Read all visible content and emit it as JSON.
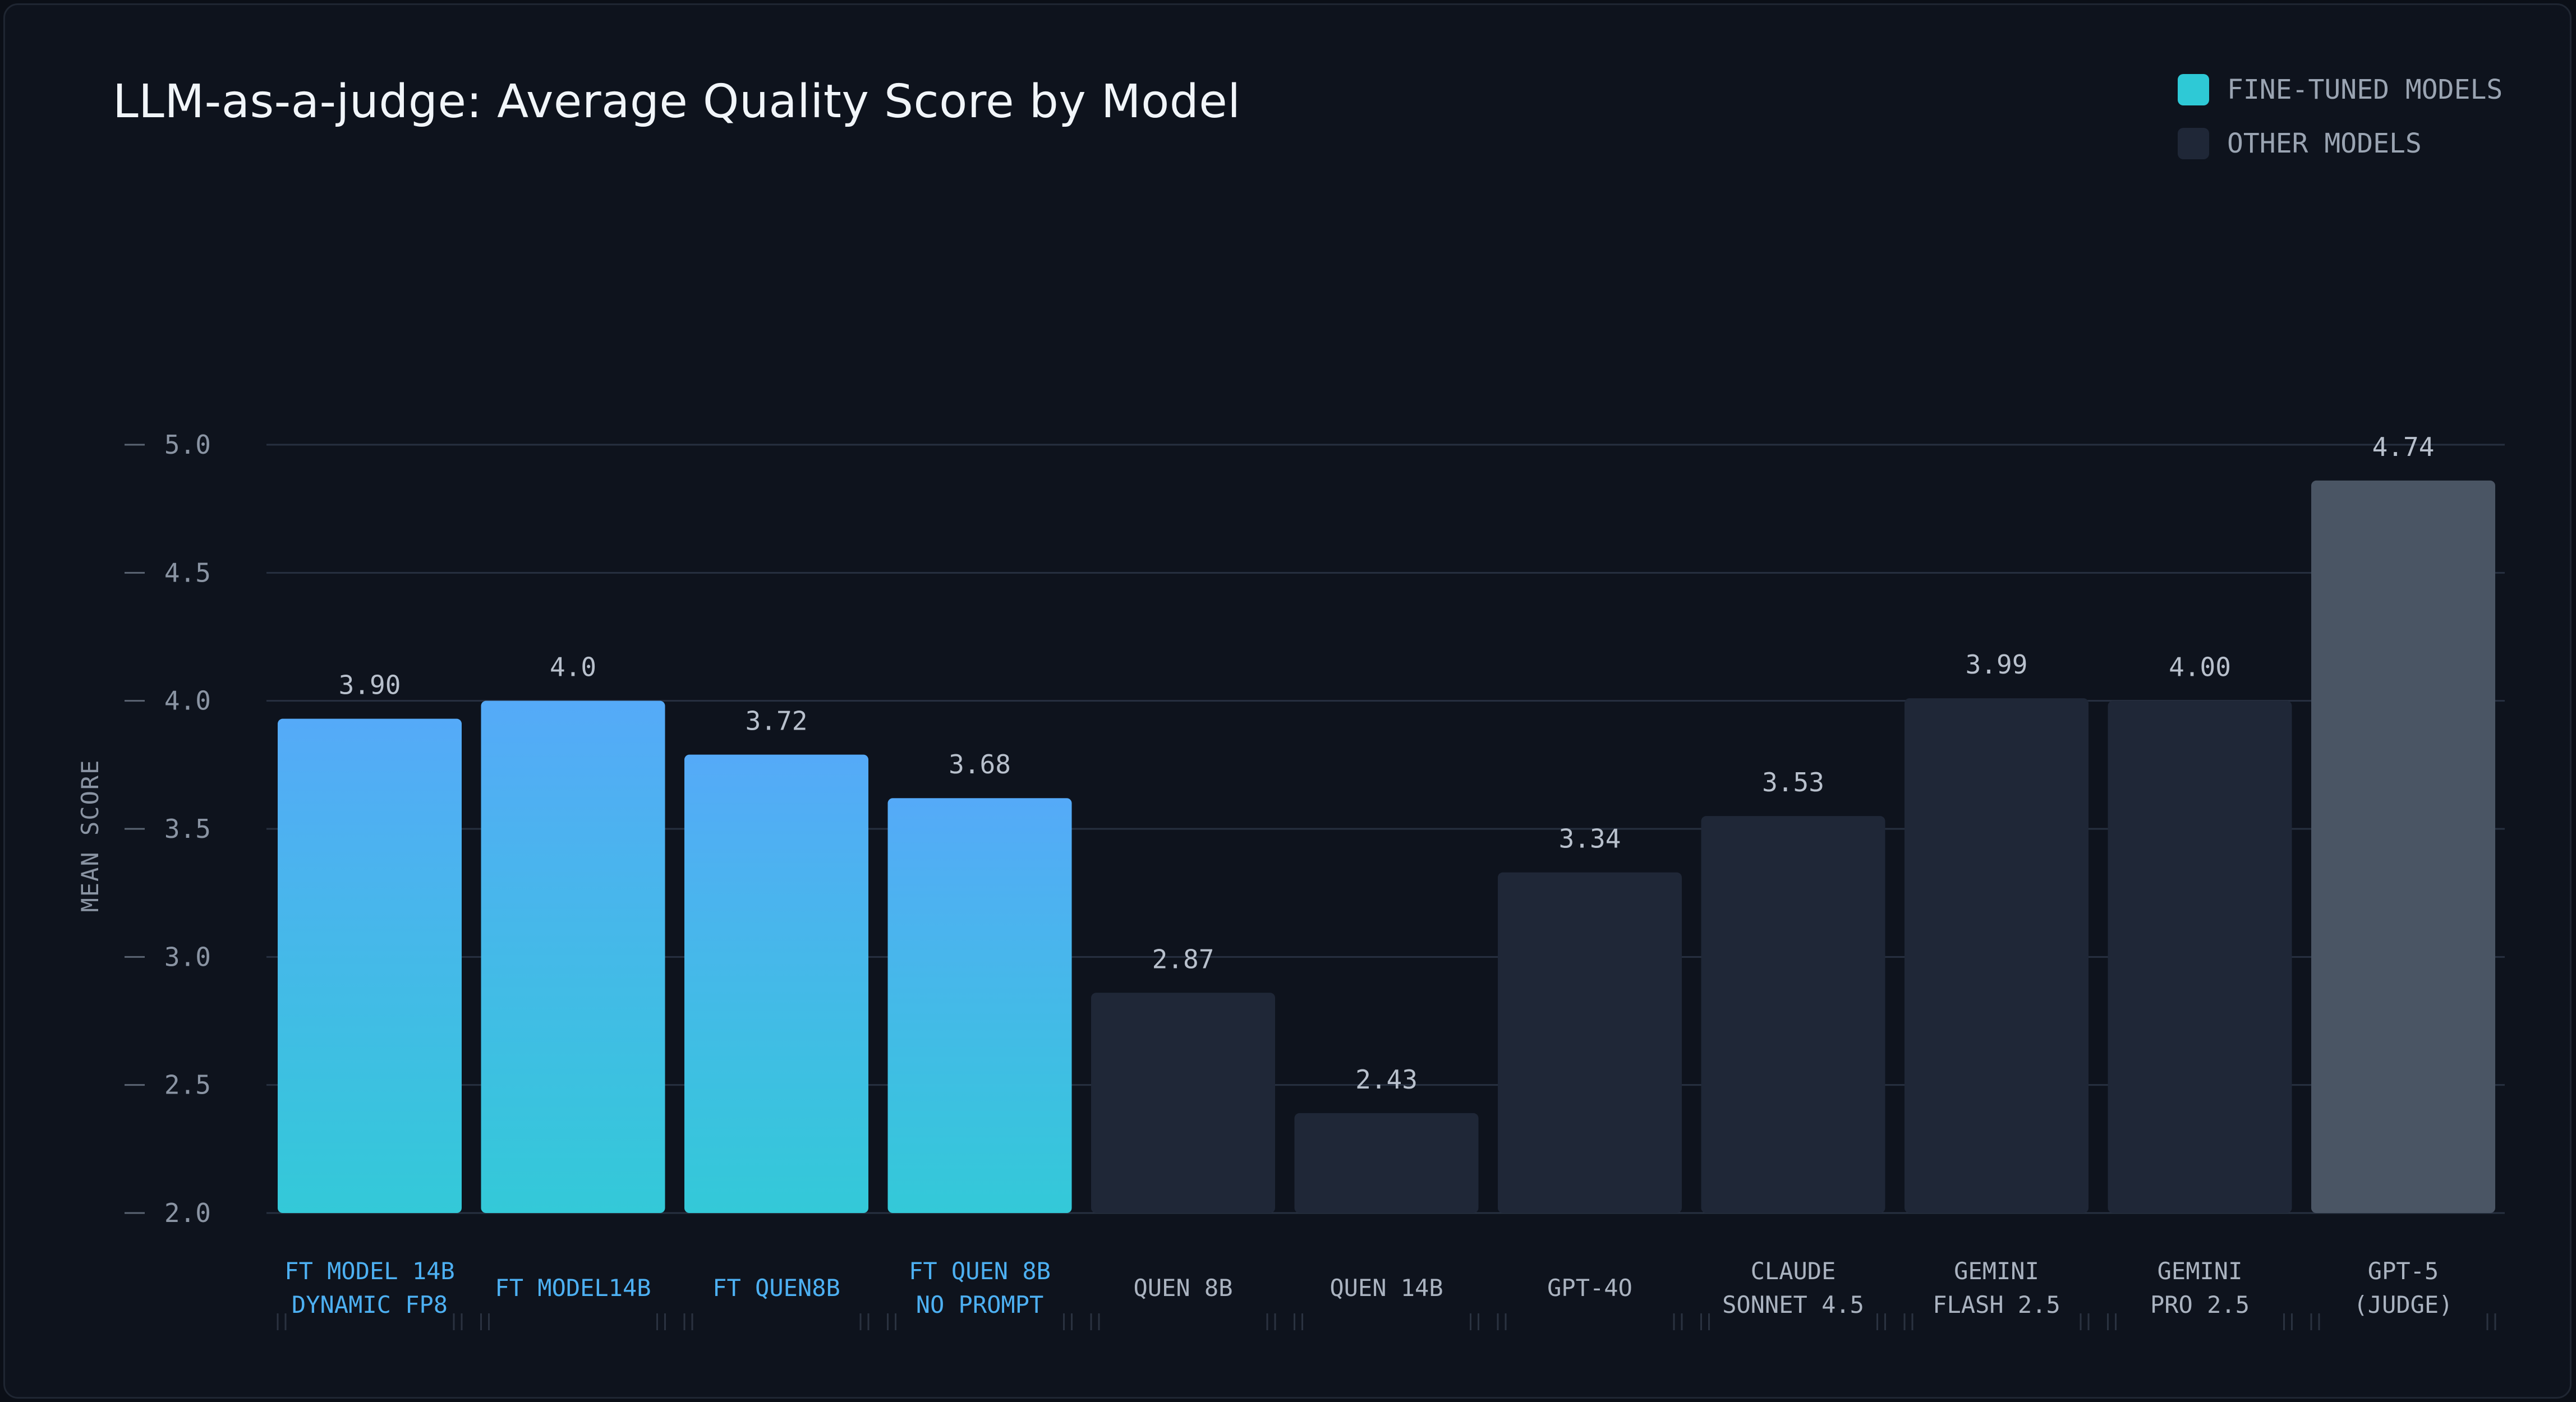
{
  "colors": {
    "finetuned_top": "#55aaf8",
    "finetuned_bottom": "#33c9d8",
    "finetuned_text": "#4db0f2",
    "other": "#1f2737",
    "other_text": "#aab3c0",
    "judge": "#4a5564",
    "legend_finetuned": "#2ec9d6",
    "legend_other": "#1f2737",
    "grid": "#273040"
  },
  "legend": [
    {
      "label": "FINE-TUNED MODELS",
      "color_key": "legend_finetuned"
    },
    {
      "label": "OTHER MODELS",
      "color_key": "legend_other"
    }
  ],
  "chart_data": {
    "type": "bar",
    "title": "LLM-as-a-judge: Average Quality Score by Model",
    "xlabel": "",
    "ylabel": "MEAN SCORE",
    "ylim": [
      2.0,
      5.0
    ],
    "yticks": [
      "2.0",
      "2.5",
      "3.0",
      "3.5",
      "4.0",
      "4.5",
      "5.0"
    ],
    "grid": true,
    "legend_position": "top-right",
    "bars": [
      {
        "category": [
          "FT MODEL 14B",
          "DYNAMIC FP8"
        ],
        "value": 3.93,
        "value_label": "3.90",
        "group": "finetuned"
      },
      {
        "category": [
          "FT MODEL14B"
        ],
        "value": 4.0,
        "value_label": "4.0",
        "group": "finetuned"
      },
      {
        "category": [
          "FT QUEN8B"
        ],
        "value": 3.79,
        "value_label": "3.72",
        "group": "finetuned"
      },
      {
        "category": [
          "FT QUEN 8B",
          "NO PROMPT"
        ],
        "value": 3.62,
        "value_label": "3.68",
        "group": "finetuned"
      },
      {
        "category": [
          "QUEN 8B"
        ],
        "value": 2.86,
        "value_label": "2.87",
        "group": "other"
      },
      {
        "category": [
          "QUEN 14B"
        ],
        "value": 2.39,
        "value_label": "2.43",
        "group": "other"
      },
      {
        "category": [
          "GPT-4O"
        ],
        "value": 3.33,
        "value_label": "3.34",
        "group": "other"
      },
      {
        "category": [
          "CLAUDE",
          "SONNET 4.5"
        ],
        "value": 3.55,
        "value_label": "3.53",
        "group": "other"
      },
      {
        "category": [
          "GEMINI",
          "FLASH 2.5"
        ],
        "value": 4.01,
        "value_label": "3.99",
        "group": "other"
      },
      {
        "category": [
          "GEMINI",
          "PRO 2.5"
        ],
        "value": 4.0,
        "value_label": "4.00",
        "group": "other"
      },
      {
        "category": [
          "GPT-5",
          "(JUDGE)"
        ],
        "value": 4.86,
        "value_label": "4.74",
        "group": "judge"
      }
    ]
  }
}
